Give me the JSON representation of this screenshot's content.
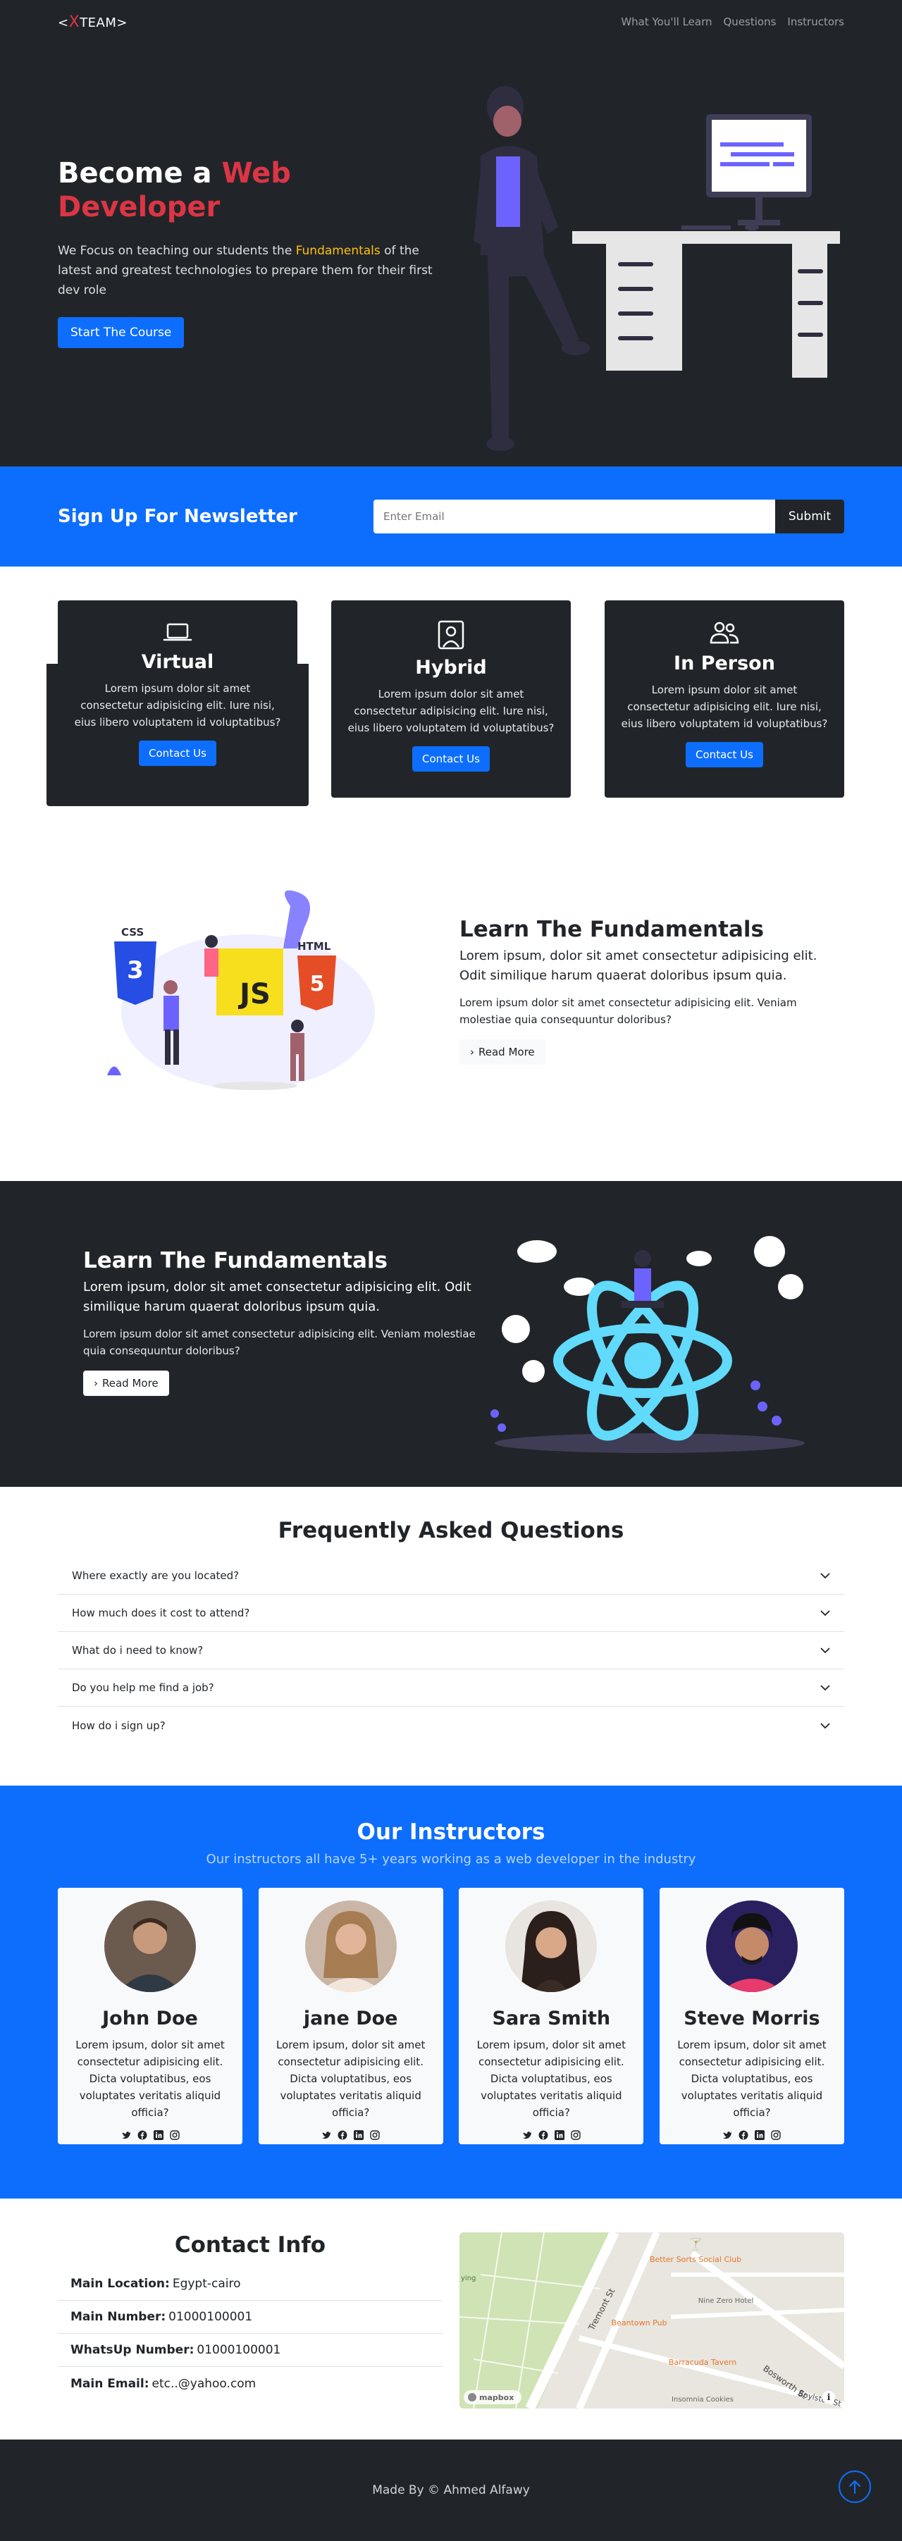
{
  "nav": {
    "brand_left": "<",
    "brand_x": "X",
    "brand_right": "TEAM>",
    "links": [
      "What You'll Learn",
      "Questions",
      "Instructors"
    ]
  },
  "hero": {
    "title_pre": "Become a ",
    "title_hl": "Web Developer",
    "lead_pre": "We Focus on teaching our students the ",
    "lead_hl": "Fundamentals",
    "lead_post": " of the latest and greatest technologies to prepare them for their first dev role",
    "button": "Start The Course"
  },
  "newsletter": {
    "title": "Sign Up For Newsletter",
    "placeholder": "Enter Email",
    "submit": "Submit"
  },
  "boxes": [
    {
      "icon": "laptop-icon",
      "title": "Virtual",
      "text": "Lorem ipsum dolor sit amet consectetur adipisicing elit. Iure nisi, eius libero voluptatem id voluptatibus?",
      "button": "Contact Us"
    },
    {
      "icon": "person-badge-icon",
      "title": "Hybrid",
      "text": "Lorem ipsum dolor sit amet consectetur adipisicing elit. Iure nisi, eius libero voluptatem id voluptatibus?",
      "button": "Contact Us"
    },
    {
      "icon": "people-icon",
      "title": "In Person",
      "text": "Lorem ipsum dolor sit amet consectetur adipisicing elit. Iure nisi, eius libero voluptatem id voluptatibus?",
      "button": "Contact Us"
    }
  ],
  "learn1": {
    "title": "Learn The Fundamentals",
    "lead": "Lorem ipsum, dolor sit amet consectetur adipisicing elit. Odit similique harum quaerat doloribus ipsum quia.",
    "text": "Lorem ipsum dolor sit amet consectetur adipisicing elit. Veniam molestiae quia consequuntur doloribus?",
    "button": "Read More",
    "img_labels": {
      "css": "CSS",
      "js": "JS",
      "html": "HTML"
    }
  },
  "learn2": {
    "title": "Learn The Fundamentals",
    "lead": "Lorem ipsum, dolor sit amet consectetur adipisicing elit. Odit similique harum quaerat doloribus ipsum quia.",
    "text": "Lorem ipsum dolor sit amet consectetur adipisicing elit. Veniam molestiae quia consequuntur doloribus?",
    "button": "Read More"
  },
  "faq": {
    "title": "Frequently Asked Questions",
    "items": [
      "Where exactly are you located?",
      "How much does it cost to attend?",
      "What do i need to know?",
      "Do you help me find a job?",
      "How do i sign up?"
    ]
  },
  "instructors": {
    "title": "Our Instructors",
    "subtitle": "Our instructors all have 5+ years working as a web developer in the industry",
    "cards": [
      {
        "name": "John Doe",
        "text": "Lorem ipsum, dolor sit amet consectetur adipisicing elit. Dicta voluptatibus, eos voluptates veritatis aliquid officia?"
      },
      {
        "name": "jane Doe",
        "text": "Lorem ipsum, dolor sit amet consectetur adipisicing elit. Dicta voluptatibus, eos voluptates veritatis aliquid officia?"
      },
      {
        "name": "Sara Smith",
        "text": "Lorem ipsum, dolor sit amet consectetur adipisicing elit. Dicta voluptatibus, eos voluptates veritatis aliquid officia?"
      },
      {
        "name": "Steve Morris",
        "text": "Lorem ipsum, dolor sit amet consectetur adipisicing elit. Dicta voluptatibus, eos voluptates veritatis aliquid officia?"
      }
    ]
  },
  "contact": {
    "title": "Contact Info",
    "rows": [
      {
        "label": "Main Location:",
        "value": "Egypt-cairo"
      },
      {
        "label": "Main Number:",
        "value": "01000100001"
      },
      {
        "label": "WhatsUp Number:",
        "value": "01000100001"
      },
      {
        "label": "Main Email:",
        "value": "etc..@yahoo.com"
      }
    ],
    "map": {
      "streets": [
        "Tremont St",
        "Boylston St",
        "Bosworth St"
      ],
      "places": [
        "Better Sorts Social Club",
        "Nine Zero Hotel",
        "Beantown Pub",
        "Barracuda Tavern",
        "Insomnia Cookies"
      ],
      "partial_label": "ying",
      "logo": "mapbox",
      "info": "i"
    }
  },
  "footer": {
    "text": "Made By © Ahmed Alfawy"
  }
}
